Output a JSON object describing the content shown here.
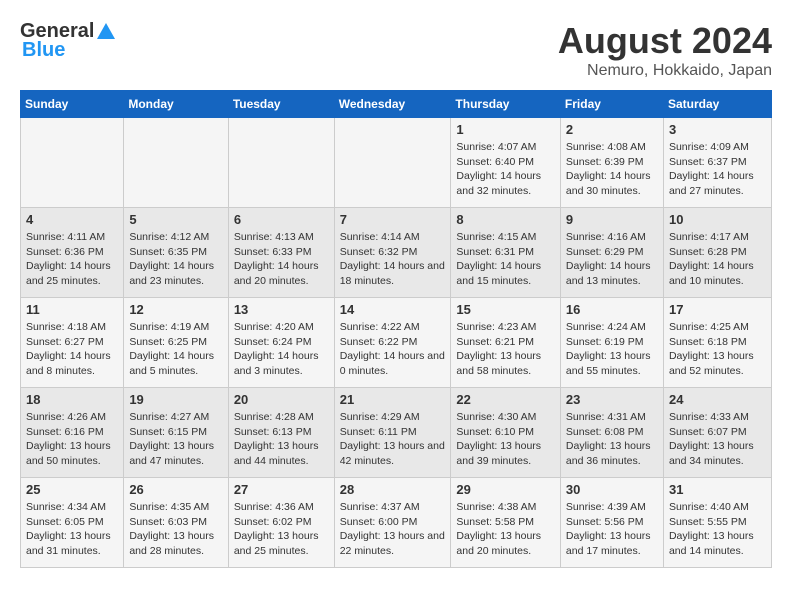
{
  "logo": {
    "general": "General",
    "blue": "Blue"
  },
  "title": "August 2024",
  "subtitle": "Nemuro, Hokkaido, Japan",
  "days_of_week": [
    "Sunday",
    "Monday",
    "Tuesday",
    "Wednesday",
    "Thursday",
    "Friday",
    "Saturday"
  ],
  "weeks": [
    [
      {
        "day": "",
        "info": ""
      },
      {
        "day": "",
        "info": ""
      },
      {
        "day": "",
        "info": ""
      },
      {
        "day": "",
        "info": ""
      },
      {
        "day": "1",
        "info": "Sunrise: 4:07 AM\nSunset: 6:40 PM\nDaylight: 14 hours and 32 minutes."
      },
      {
        "day": "2",
        "info": "Sunrise: 4:08 AM\nSunset: 6:39 PM\nDaylight: 14 hours and 30 minutes."
      },
      {
        "day": "3",
        "info": "Sunrise: 4:09 AM\nSunset: 6:37 PM\nDaylight: 14 hours and 27 minutes."
      }
    ],
    [
      {
        "day": "4",
        "info": "Sunrise: 4:11 AM\nSunset: 6:36 PM\nDaylight: 14 hours and 25 minutes."
      },
      {
        "day": "5",
        "info": "Sunrise: 4:12 AM\nSunset: 6:35 PM\nDaylight: 14 hours and 23 minutes."
      },
      {
        "day": "6",
        "info": "Sunrise: 4:13 AM\nSunset: 6:33 PM\nDaylight: 14 hours and 20 minutes."
      },
      {
        "day": "7",
        "info": "Sunrise: 4:14 AM\nSunset: 6:32 PM\nDaylight: 14 hours and 18 minutes."
      },
      {
        "day": "8",
        "info": "Sunrise: 4:15 AM\nSunset: 6:31 PM\nDaylight: 14 hours and 15 minutes."
      },
      {
        "day": "9",
        "info": "Sunrise: 4:16 AM\nSunset: 6:29 PM\nDaylight: 14 hours and 13 minutes."
      },
      {
        "day": "10",
        "info": "Sunrise: 4:17 AM\nSunset: 6:28 PM\nDaylight: 14 hours and 10 minutes."
      }
    ],
    [
      {
        "day": "11",
        "info": "Sunrise: 4:18 AM\nSunset: 6:27 PM\nDaylight: 14 hours and 8 minutes."
      },
      {
        "day": "12",
        "info": "Sunrise: 4:19 AM\nSunset: 6:25 PM\nDaylight: 14 hours and 5 minutes."
      },
      {
        "day": "13",
        "info": "Sunrise: 4:20 AM\nSunset: 6:24 PM\nDaylight: 14 hours and 3 minutes."
      },
      {
        "day": "14",
        "info": "Sunrise: 4:22 AM\nSunset: 6:22 PM\nDaylight: 14 hours and 0 minutes."
      },
      {
        "day": "15",
        "info": "Sunrise: 4:23 AM\nSunset: 6:21 PM\nDaylight: 13 hours and 58 minutes."
      },
      {
        "day": "16",
        "info": "Sunrise: 4:24 AM\nSunset: 6:19 PM\nDaylight: 13 hours and 55 minutes."
      },
      {
        "day": "17",
        "info": "Sunrise: 4:25 AM\nSunset: 6:18 PM\nDaylight: 13 hours and 52 minutes."
      }
    ],
    [
      {
        "day": "18",
        "info": "Sunrise: 4:26 AM\nSunset: 6:16 PM\nDaylight: 13 hours and 50 minutes."
      },
      {
        "day": "19",
        "info": "Sunrise: 4:27 AM\nSunset: 6:15 PM\nDaylight: 13 hours and 47 minutes."
      },
      {
        "day": "20",
        "info": "Sunrise: 4:28 AM\nSunset: 6:13 PM\nDaylight: 13 hours and 44 minutes."
      },
      {
        "day": "21",
        "info": "Sunrise: 4:29 AM\nSunset: 6:11 PM\nDaylight: 13 hours and 42 minutes."
      },
      {
        "day": "22",
        "info": "Sunrise: 4:30 AM\nSunset: 6:10 PM\nDaylight: 13 hours and 39 minutes."
      },
      {
        "day": "23",
        "info": "Sunrise: 4:31 AM\nSunset: 6:08 PM\nDaylight: 13 hours and 36 minutes."
      },
      {
        "day": "24",
        "info": "Sunrise: 4:33 AM\nSunset: 6:07 PM\nDaylight: 13 hours and 34 minutes."
      }
    ],
    [
      {
        "day": "25",
        "info": "Sunrise: 4:34 AM\nSunset: 6:05 PM\nDaylight: 13 hours and 31 minutes."
      },
      {
        "day": "26",
        "info": "Sunrise: 4:35 AM\nSunset: 6:03 PM\nDaylight: 13 hours and 28 minutes."
      },
      {
        "day": "27",
        "info": "Sunrise: 4:36 AM\nSunset: 6:02 PM\nDaylight: 13 hours and 25 minutes."
      },
      {
        "day": "28",
        "info": "Sunrise: 4:37 AM\nSunset: 6:00 PM\nDaylight: 13 hours and 22 minutes."
      },
      {
        "day": "29",
        "info": "Sunrise: 4:38 AM\nSunset: 5:58 PM\nDaylight: 13 hours and 20 minutes."
      },
      {
        "day": "30",
        "info": "Sunrise: 4:39 AM\nSunset: 5:56 PM\nDaylight: 13 hours and 17 minutes."
      },
      {
        "day": "31",
        "info": "Sunrise: 4:40 AM\nSunset: 5:55 PM\nDaylight: 13 hours and 14 minutes."
      }
    ]
  ]
}
